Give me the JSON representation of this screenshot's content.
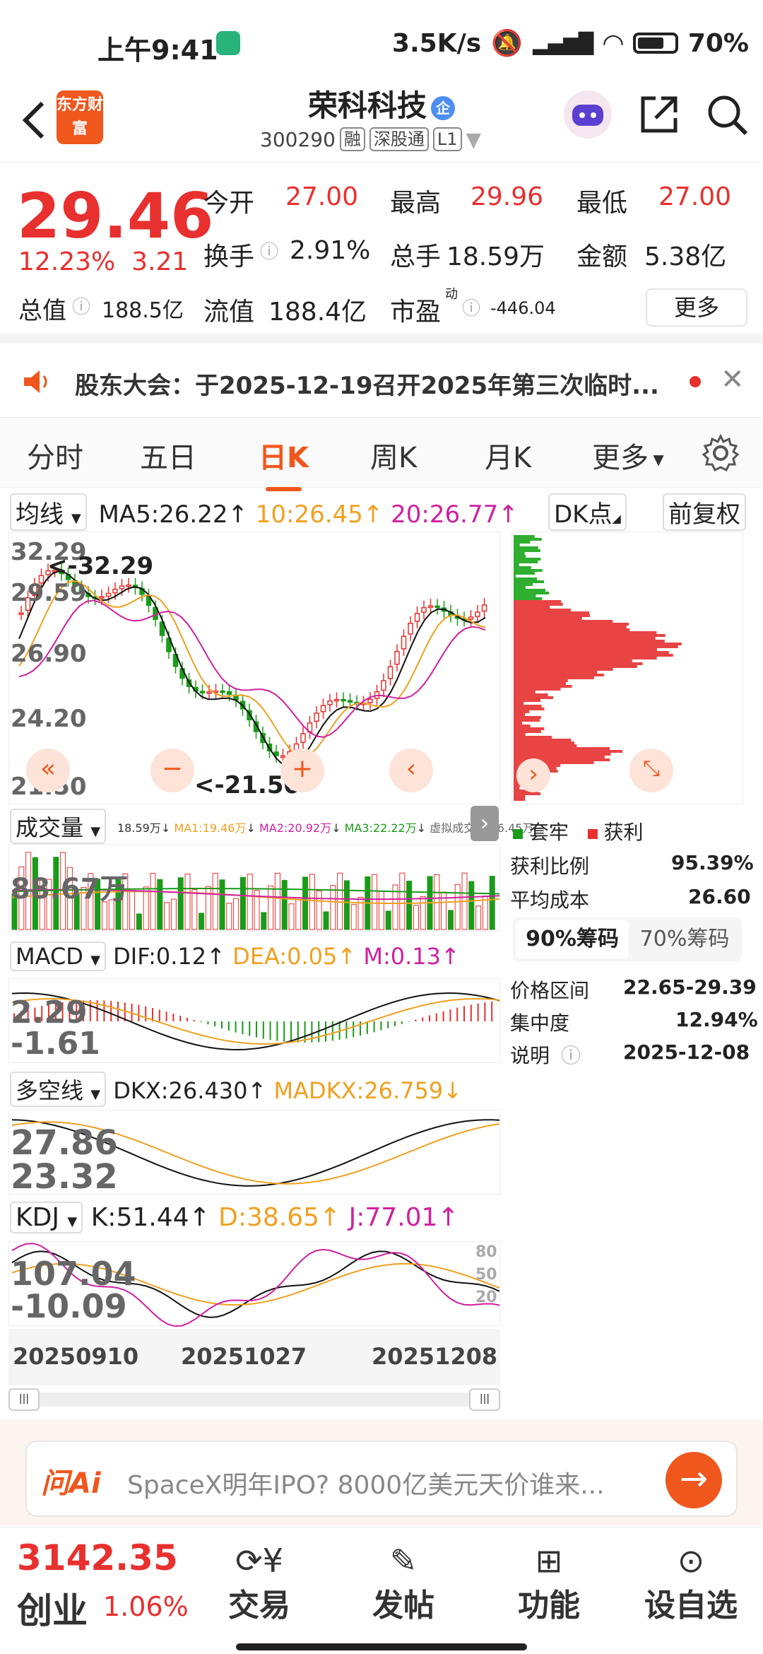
{
  "status": {
    "time": "上午9:41",
    "speed": "3.5K/s",
    "battery": "70%"
  },
  "header": {
    "logo": "东方财富",
    "name": "荣科科技",
    "qi_badge": "企",
    "code": "300290",
    "tags": [
      "融",
      "深股通",
      "L1"
    ]
  },
  "quote": {
    "price": "29.46",
    "pct": "12.23%",
    "chg": "3.21",
    "rows": [
      {
        "l1": "今开",
        "v1": "27.00",
        "l2": "最高",
        "v2": "29.96",
        "l3": "最低",
        "v3": "27.00"
      },
      {
        "l1": "换手",
        "v1": "2.91%",
        "l2": "总手",
        "v2": "18.59万",
        "l3": "金额",
        "v3": "5.38亿"
      },
      {
        "l1": "总值",
        "v1": "188.5亿",
        "l2": "流值",
        "v2": "188.4亿",
        "l3": "市盈",
        "v3": "-446.04"
      }
    ],
    "pe_sup": "动",
    "more": "更多"
  },
  "notice": {
    "text": "股东大会：于2025-12-19召开2025年第三次临时..."
  },
  "tabs": [
    "分时",
    "五日",
    "日K",
    "周K",
    "月K",
    "更多"
  ],
  "ma": {
    "label": "均线",
    "ma5": "MA5:26.22",
    "ma10": "10:26.45",
    "ma20": "20:26.77",
    "dk": "DK点",
    "fq": "前复权"
  },
  "k_axis": {
    "y": [
      "32.29",
      "29.59",
      "26.90",
      "24.20",
      "21.50"
    ],
    "hi": "<-32.29",
    "lo": "<-21.50"
  },
  "vol": {
    "label": "成交量",
    "v": "18.59万",
    "ma1": "MA1:19.46万",
    "ma2": "MA2:20.92万",
    "ma3": "MA3:22.22万",
    "sim": "虚拟成交量:36.45万",
    "axis": "88.67万"
  },
  "macd": {
    "label": "MACD",
    "dif": "DIF:0.12",
    "dea": "DEA:0.05",
    "m": "M:0.13",
    "hi": "2.29",
    "lo": "-1.61"
  },
  "dkx": {
    "label": "多空线",
    "dkx": "DKX:26.430",
    "madkx": "MADKX:26.759",
    "hi": "27.86",
    "lo": "23.32"
  },
  "kdj": {
    "label": "KDJ",
    "k": "K:51.44",
    "d": "D:38.65",
    "j": "J:77.01",
    "hi": "107.04",
    "lo": "-10.09",
    "r80": "80",
    "r50": "50",
    "r20": "20"
  },
  "dates": [
    "20250910",
    "20251027",
    "20251208"
  ],
  "chips": {
    "legend1": "套牢",
    "legend2": "获利",
    "rows": [
      {
        "k": "获利比例",
        "v": "95.39%"
      },
      {
        "k": "平均成本",
        "v": "26.60"
      }
    ],
    "tab1": "90%筹码",
    "tab2": "70%筹码",
    "rows2": [
      {
        "k": "价格区间",
        "v": "22.65-29.39"
      },
      {
        "k": "集中度",
        "v": "12.94%"
      },
      {
        "k": "说明",
        "v": "2025-12-08"
      }
    ]
  },
  "ad": {
    "brand": "问Ai",
    "text": "SpaceX明年IPO? 8000亿美元天价谁来..."
  },
  "bottom": {
    "index": "3142.35",
    "name": "创业",
    "pct": "1.06%",
    "nav": [
      "交易",
      "发帖",
      "功能",
      "设自选"
    ]
  },
  "colors": {
    "red": "#e8302e",
    "green": "#1a9b1a",
    "orange": "#f0571d",
    "ma10": "#f0a020",
    "ma20": "#d020a0"
  }
}
